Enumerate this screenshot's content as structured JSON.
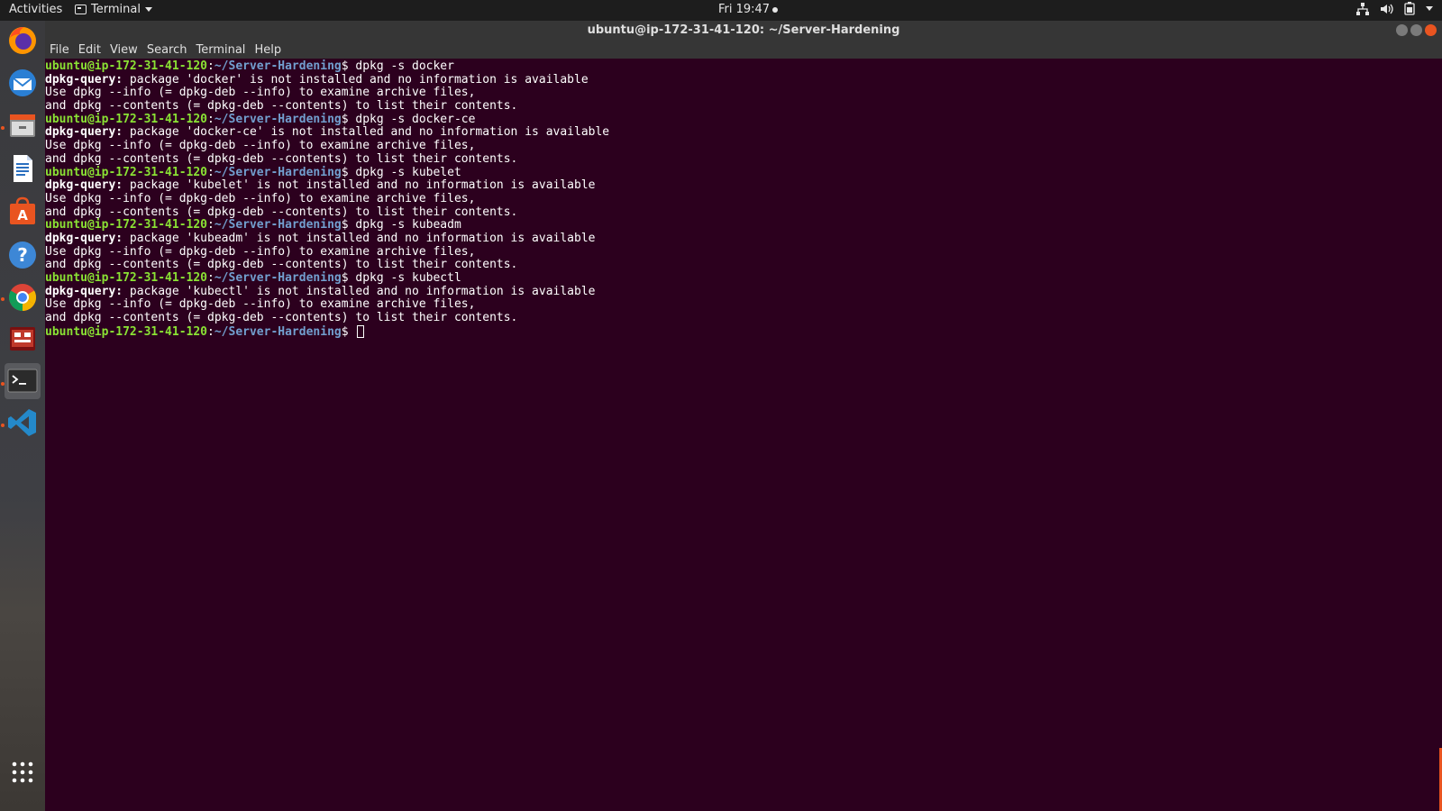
{
  "topbar": {
    "activities": "Activities",
    "app_name": "Terminal",
    "clock": "Fri 19:47",
    "icons": [
      "network-icon",
      "volume-icon",
      "battery-icon",
      "system-menu-icon"
    ]
  },
  "dock": {
    "items": [
      "firefox-icon",
      "thunderbird-icon",
      "files-icon",
      "writer-icon",
      "software-center-icon",
      "help-icon",
      "chrome-icon",
      "remote-desktop-icon",
      "terminal-icon",
      "vscode-icon",
      "show-apps-icon"
    ]
  },
  "window": {
    "title": "ubuntu@ip-172-31-41-120: ~/Server-Hardening",
    "menu": [
      "File",
      "Edit",
      "View",
      "Search",
      "Terminal",
      "Help"
    ]
  },
  "prompt": {
    "user_host": "ubuntu@ip-172-31-41-120",
    "sep": ":",
    "path": "~/Server-Hardening",
    "symbol": "$ "
  },
  "session": [
    {
      "command": "dpkg -s docker",
      "error_label": "dpkg-query:",
      "error_text": " package 'docker' is not installed and no information is available",
      "info1": "Use dpkg --info (= dpkg-deb --info) to examine archive files,",
      "info2": "and dpkg --contents (= dpkg-deb --contents) to list their contents."
    },
    {
      "command": "dpkg -s docker-ce",
      "error_label": "dpkg-query:",
      "error_text": " package 'docker-ce' is not installed and no information is available",
      "info1": "Use dpkg --info (= dpkg-deb --info) to examine archive files,",
      "info2": "and dpkg --contents (= dpkg-deb --contents) to list their contents."
    },
    {
      "command": "dpkg -s kubelet",
      "error_label": "dpkg-query:",
      "error_text": " package 'kubelet' is not installed and no information is available",
      "info1": "Use dpkg --info (= dpkg-deb --info) to examine archive files,",
      "info2": "and dpkg --contents (= dpkg-deb --contents) to list their contents."
    },
    {
      "command": "dpkg -s kubeadm",
      "error_label": "dpkg-query:",
      "error_text": " package 'kubeadm' is not installed and no information is available",
      "info1": "Use dpkg --info (= dpkg-deb --info) to examine archive files,",
      "info2": "and dpkg --contents (= dpkg-deb --contents) to list their contents."
    },
    {
      "command": "dpkg -s kubectl",
      "error_label": "dpkg-query:",
      "error_text": " package 'kubectl' is not installed and no information is available",
      "info1": "Use dpkg --info (= dpkg-deb --info) to examine archive files,",
      "info2": "and dpkg --contents (= dpkg-deb --contents) to list their contents."
    }
  ],
  "colors": {
    "terminal_bg": "#2c001e",
    "prompt_user": "#8ae234",
    "prompt_path": "#729fcf",
    "accent": "#e95420"
  }
}
